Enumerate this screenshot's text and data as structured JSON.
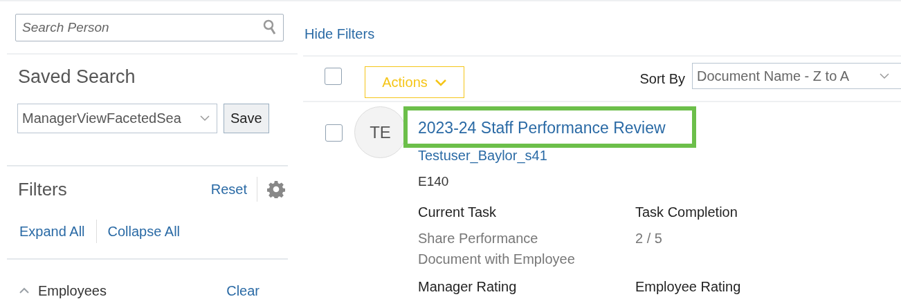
{
  "sidebar": {
    "search": {
      "placeholder": "Search Person"
    },
    "saved_search": {
      "title": "Saved Search",
      "value": "ManagerViewFacetedSea",
      "save_button": "Save"
    },
    "filters": {
      "title": "Filters",
      "reset": "Reset",
      "expand_all": "Expand All",
      "collapse_all": "Collapse All"
    },
    "sections": [
      {
        "label": "Employees",
        "expanded": true,
        "clear": "Clear"
      }
    ]
  },
  "main": {
    "hide_filters": "Hide Filters",
    "toolbar": {
      "select_all": {
        "checked": false
      },
      "actions": "Actions",
      "sort_label": "Sort By",
      "sort_value": "Document Name - Z to A"
    },
    "documents": [
      {
        "checked": false,
        "initials": "TE",
        "title": "2023-24 Staff Performance Review",
        "highlighted": true,
        "person": "Testuser_Baylor_s41",
        "person_id": "E140",
        "fields": [
          {
            "label": "Current Task",
            "value": "Share Performance Document with Employee"
          },
          {
            "label": "Task Completion",
            "value": "2 / 5"
          },
          {
            "label": "Manager Rating"
          },
          {
            "label": "Employee Rating"
          }
        ]
      }
    ]
  }
}
